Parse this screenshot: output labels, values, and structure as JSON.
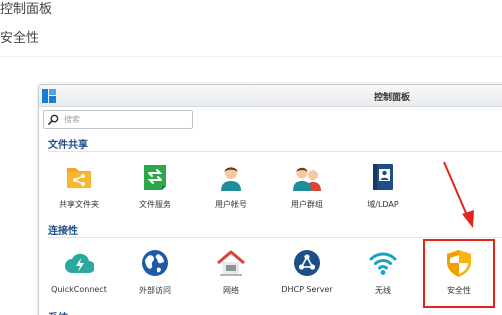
{
  "breadcrumb": {
    "line1": "控制面板",
    "line2": "安全性"
  },
  "window": {
    "title": "控制面板",
    "search_placeholder": "搜索"
  },
  "sections": [
    {
      "title": "文件共享",
      "items": [
        {
          "label": "共享文件夹",
          "icon": "shared-folder-icon"
        },
        {
          "label": "文件服务",
          "icon": "file-services-icon"
        },
        {
          "label": "用户帐号",
          "icon": "user-icon"
        },
        {
          "label": "用户群组",
          "icon": "group-icon"
        },
        {
          "label": "域/LDAP",
          "icon": "domain-ldap-icon"
        }
      ]
    },
    {
      "title": "连接性",
      "items": [
        {
          "label": "QuickConnect",
          "icon": "quickconnect-icon"
        },
        {
          "label": "外部访问",
          "icon": "external-access-icon"
        },
        {
          "label": "网络",
          "icon": "network-icon"
        },
        {
          "label": "DHCP Server",
          "icon": "dhcp-server-icon"
        },
        {
          "label": "无线",
          "icon": "wireless-icon"
        },
        {
          "label": "安全性",
          "icon": "security-shield-icon"
        }
      ]
    },
    {
      "title": "系统",
      "items": []
    }
  ],
  "colors": {
    "accent_red": "#e0251b",
    "section_title": "#1e4e86",
    "security_yellow": "#f6b50e"
  }
}
